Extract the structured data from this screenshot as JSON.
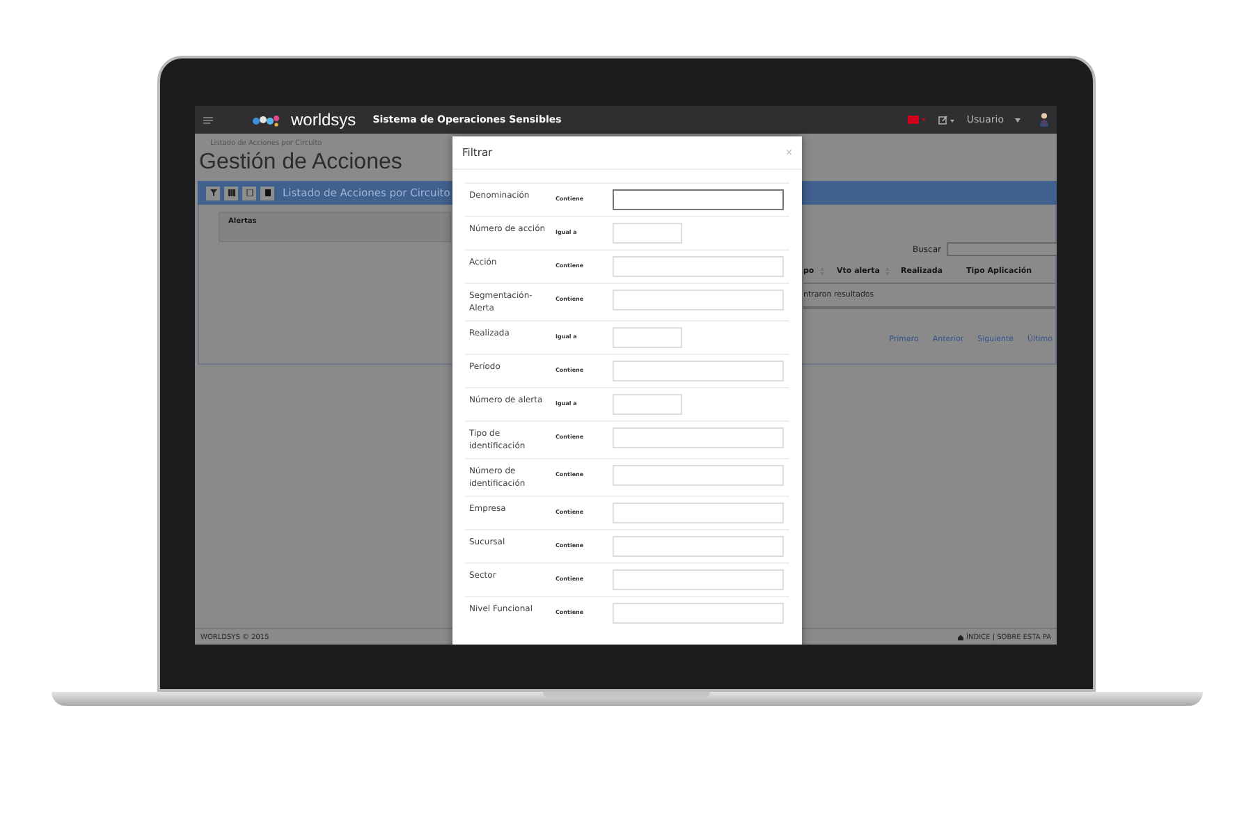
{
  "nav": {
    "brand": "worldsys",
    "system_title": "Sistema de Operaciones Sensibles",
    "user": "Usuario"
  },
  "page": {
    "breadcrumb": "Listado de Acciones por Circuito",
    "title": "Gestión de Acciones",
    "toolbar_title": "Listado de Acciones por Circuito"
  },
  "alerts_panel": {
    "title": "Alertas"
  },
  "search": {
    "label": "Buscar"
  },
  "table": {
    "columns": [
      {
        "label": "po",
        "sortable": true
      },
      {
        "label": "Vto alerta",
        "sortable": true
      },
      {
        "label": "Realizada",
        "sortable": false
      },
      {
        "label": "Tipo Aplicación",
        "sortable": false
      }
    ],
    "empty_message": "ntraron resultados"
  },
  "pagination": [
    "Primero",
    "Anterior",
    "Siguiente",
    "Último"
  ],
  "footer": {
    "copyright": "WORLDSYS © 2015",
    "links": "ÍNDICE | SOBRE ESTA PA"
  },
  "modal": {
    "title": "Filtrar",
    "close": "×",
    "filters": [
      {
        "label": "Denominación",
        "operator": "Contiene",
        "kind": "text",
        "focused": true
      },
      {
        "label": "Número de acción",
        "operator": "Igual a",
        "kind": "number",
        "focused": false
      },
      {
        "label": "Acción",
        "operator": "Contiene",
        "kind": "text",
        "focused": false
      },
      {
        "label": "Segmentación-Alerta",
        "operator": "Contiene",
        "kind": "text",
        "focused": false
      },
      {
        "label": "Realizada",
        "operator": "Igual a",
        "kind": "number",
        "focused": false
      },
      {
        "label": "Período",
        "operator": "Contiene",
        "kind": "text",
        "focused": false
      },
      {
        "label": "Número de alerta",
        "operator": "Igual a",
        "kind": "number",
        "focused": false
      },
      {
        "label": "Tipo de identificación",
        "operator": "Contiene",
        "kind": "text",
        "focused": false
      },
      {
        "label": "Número de identificación",
        "operator": "Contiene",
        "kind": "text",
        "focused": false
      },
      {
        "label": "Empresa",
        "operator": "Contiene",
        "kind": "text",
        "focused": false
      },
      {
        "label": "Sucursal",
        "operator": "Contiene",
        "kind": "text",
        "focused": false
      },
      {
        "label": "Sector",
        "operator": "Contiene",
        "kind": "text",
        "focused": false
      },
      {
        "label": "Nivel Funcional",
        "operator": "Contiene",
        "kind": "text",
        "focused": false
      }
    ]
  }
}
